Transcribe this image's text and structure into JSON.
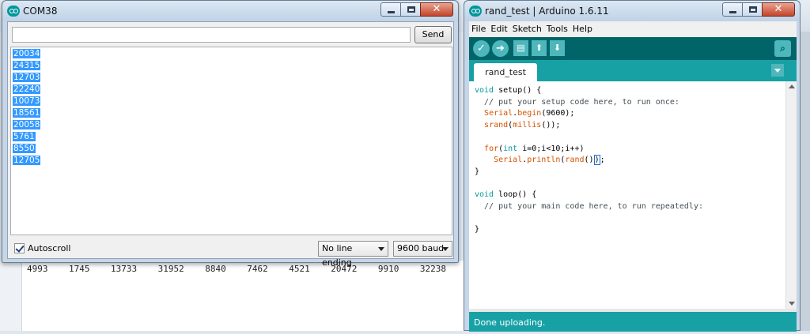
{
  "background": {
    "numbers": [
      "4993",
      "1745",
      "13733",
      "31952",
      "8840",
      "7462",
      "4521",
      "20472",
      "9910",
      "32238"
    ]
  },
  "serial_monitor": {
    "title": "COM38",
    "input_value": "",
    "send_label": "Send",
    "output_lines": [
      "20034",
      "24315",
      "12703",
      "22240",
      "10073",
      "18561",
      "20058",
      "5761",
      "8550",
      "12705"
    ],
    "autoscroll_label": "Autoscroll",
    "autoscroll_checked": true,
    "line_ending": "No line ending",
    "baud": "9600 baud"
  },
  "ide": {
    "title": "rand_test | Arduino 1.6.11",
    "menu": [
      "File",
      "Edit",
      "Sketch",
      "Tools",
      "Help"
    ],
    "toolbar": {
      "verify": "✓",
      "upload": "➔",
      "new": "▤",
      "open": "⬆",
      "save": "⬇",
      "serial": "⌕"
    },
    "tab_label": "rand_test",
    "code": {
      "l1a": "void",
      "l1b": " setup() {",
      "l2": "  // put your setup code here, to run once:",
      "l3a": "  ",
      "l3b": "Serial",
      "l3c": ".",
      "l3d": "begin",
      "l3e": "(9600);",
      "l4a": "  ",
      "l4b": "srand",
      "l4c": "(",
      "l4d": "millis",
      "l4e": "());",
      "l5": "",
      "l6a": "  ",
      "l6b": "for",
      "l6c": "(",
      "l6d": "int",
      "l6e": " i=0;i<10;i++)",
      "l7a": "    ",
      "l7b": "Serial",
      "l7c": ".",
      "l7d": "println",
      "l7e": "(",
      "l7f": "rand",
      "l7g": "()",
      "l7h": ")",
      "l7i": ";",
      "l8": "}",
      "l9": "",
      "l10a": "void",
      "l10b": " loop() {",
      "l11": "  // put your main code here, to run repeatedly:",
      "l12": "",
      "l13": "}"
    },
    "status": "Done uploading."
  },
  "colors": {
    "arduino_dark": "#006468",
    "arduino_teal": "#17a1a5",
    "selection": "#3399ff"
  }
}
